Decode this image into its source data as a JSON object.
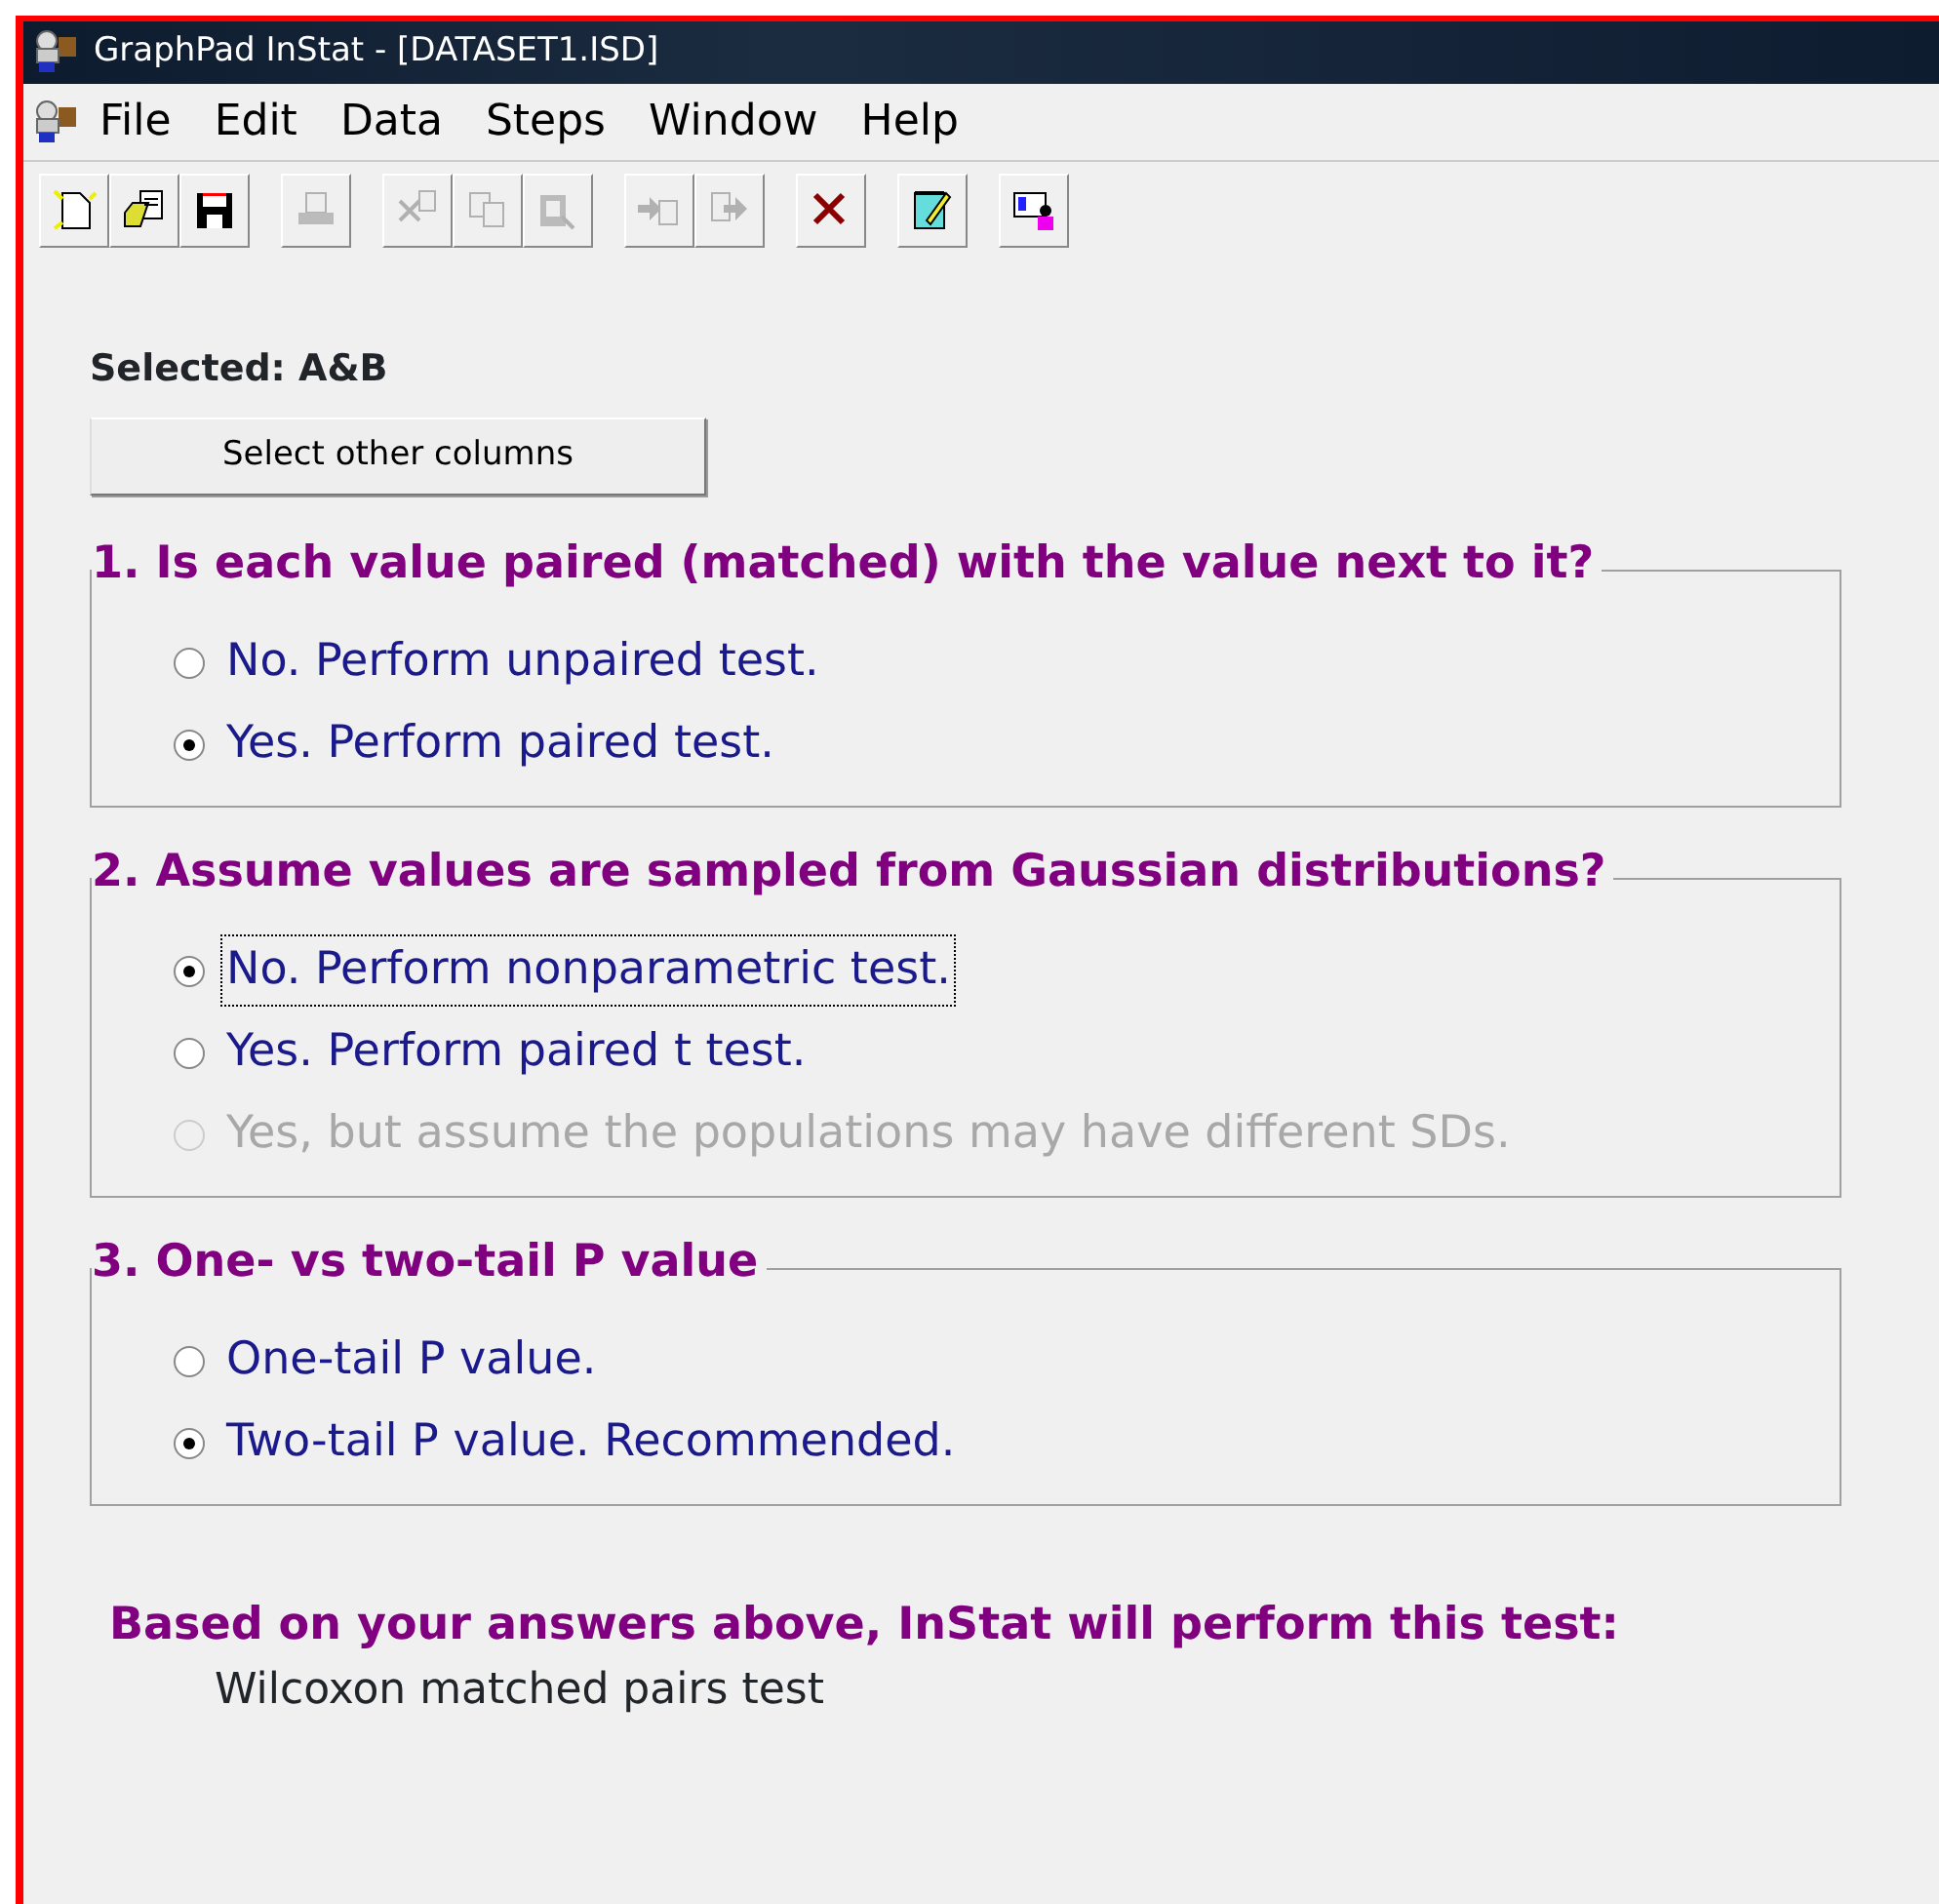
{
  "window": {
    "title": "GraphPad InStat - [DATASET1.ISD]"
  },
  "menu": [
    "File",
    "Edit",
    "Data",
    "Steps",
    "Window",
    "Help"
  ],
  "toolbar": [
    {
      "buttons": [
        {
          "kind": "new",
          "disabled": false
        },
        {
          "kind": "open",
          "disabled": false
        },
        {
          "kind": "save",
          "disabled": false
        }
      ]
    },
    {
      "buttons": [
        {
          "kind": "print",
          "disabled": true
        }
      ]
    },
    {
      "buttons": [
        {
          "kind": "cut",
          "disabled": true
        },
        {
          "kind": "copy",
          "disabled": true
        },
        {
          "kind": "paste",
          "disabled": true
        }
      ]
    },
    {
      "buttons": [
        {
          "kind": "import",
          "disabled": true
        },
        {
          "kind": "export",
          "disabled": true
        }
      ]
    },
    {
      "buttons": [
        {
          "kind": "delete",
          "disabled": false
        }
      ]
    },
    {
      "buttons": [
        {
          "kind": "notes",
          "disabled": false
        }
      ]
    },
    {
      "buttons": [
        {
          "kind": "presentation",
          "disabled": false
        }
      ]
    }
  ],
  "selected_label": "Selected: A&B",
  "select_button": "Select other columns",
  "questions": [
    {
      "title": "1. Is each value paired (matched) with the value next to it?",
      "options": [
        {
          "label": "No. Perform unpaired test.",
          "selected": false,
          "disabled": false,
          "focused": false
        },
        {
          "label": "Yes. Perform paired test.",
          "selected": true,
          "disabled": false,
          "focused": false
        }
      ]
    },
    {
      "title": "2. Assume values are sampled from Gaussian distributions?",
      "options": [
        {
          "label": "No. Perform nonparametric test.",
          "selected": true,
          "disabled": false,
          "focused": true
        },
        {
          "label": "Yes. Perform paired t test.",
          "selected": false,
          "disabled": false,
          "focused": false
        },
        {
          "label": "Yes, but assume the populations may have different SDs.",
          "selected": false,
          "disabled": true,
          "focused": false
        }
      ]
    },
    {
      "title": "3. One- vs two-tail P value",
      "options": [
        {
          "label": "One-tail P value.",
          "selected": false,
          "disabled": false,
          "focused": false
        },
        {
          "label": "Two-tail P value. Recommended.",
          "selected": true,
          "disabled": false,
          "focused": false
        }
      ]
    }
  ],
  "result": {
    "heading": "Based on your answers above, InStat will perform this test:",
    "test": "Wilcoxon matched pairs test"
  }
}
